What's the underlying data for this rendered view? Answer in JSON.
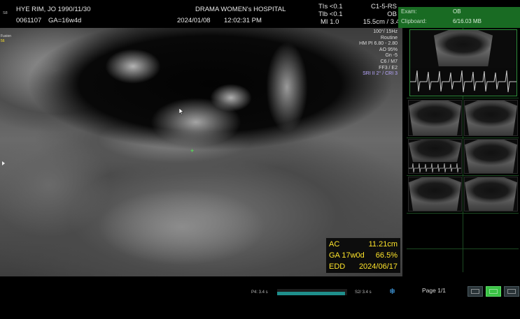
{
  "header": {
    "left_small": "S8",
    "patient_name": "HYE RIM, JO  1990/11/30",
    "patient_id": "0061107",
    "gestational_age": "GA=16w4d",
    "hospital": "DRAMA WOMEN's HOSPITAL",
    "date": "2024/01/08",
    "time": "12:02:31 PM",
    "tis_label": "TIs <0.1",
    "tib_label": "Tlb <0.1",
    "mi_label": "MI  1.0",
    "probe": "C1-5-RS",
    "preset": "OB",
    "depth": "15.5cm / 3.4"
  },
  "params": {
    "lines": [
      "100°/ 15Hz",
      "Routine",
      "HM PI 6.80 - 2.80",
      "AO 95%",
      "Gn -5",
      "C6 / M7",
      "FF3 / E2"
    ],
    "sri_line": "SRI II 2° / CRI 3"
  },
  "left_markers": {
    "top_label": "Fusion",
    "top_value": "56"
  },
  "measurement": {
    "ac_label": "AC",
    "ac_value": "11.21cm",
    "ga_label": "GA 17w0d",
    "ga_percent": "66.5%",
    "edd_label": "EDD",
    "edd_value": "2024/06/17"
  },
  "side_panel": {
    "exam_label": "Exam:",
    "exam_value": "OB",
    "clipboard_label": "Clipboard:",
    "clipboard_value": "6/16.03 MB",
    "page_label": "Page 1/1"
  },
  "bottom_bar": {
    "p4_label": "P4: 3.4 s",
    "s2_label": "S2/ 3.4 s",
    "cine_progress": 0.97
  },
  "colors": {
    "measurement_text": "#ffe52a",
    "info_bar": "#196b23",
    "progress_fill": "#1f8f8c",
    "active_button": "#39c144",
    "sri_text": "#b9a8ff"
  }
}
